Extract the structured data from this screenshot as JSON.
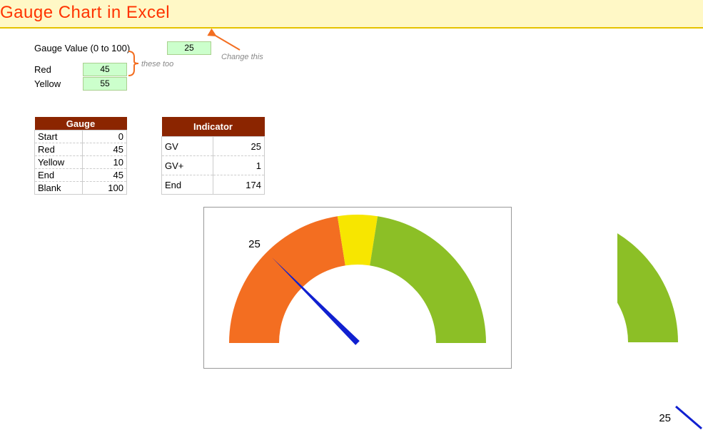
{
  "title": "Gauge Chart in Excel",
  "inputs": {
    "gauge_value_label": "Gauge Value (0 to 100)",
    "gauge_value": "25",
    "red_label": "Red",
    "red_value": "45",
    "yellow_label": "Yellow",
    "yellow_value": "55"
  },
  "notes": {
    "change_this": "Change this",
    "these_too": "these too"
  },
  "tables": {
    "gauge": {
      "header": "Gauge",
      "rows": [
        {
          "label": "Start",
          "value": "0"
        },
        {
          "label": "Red",
          "value": "45"
        },
        {
          "label": "Yellow",
          "value": "10"
        },
        {
          "label": "End",
          "value": "45"
        },
        {
          "label": "Blank",
          "value": "100"
        }
      ]
    },
    "indicator": {
      "header": "Indicator",
      "rows": [
        {
          "label": "GV",
          "value": "25"
        },
        {
          "label": "GV+",
          "value": "1"
        },
        {
          "label": "End",
          "value": "174"
        }
      ]
    }
  },
  "chart_data": {
    "type": "pie",
    "title": "",
    "gauge_value": 25,
    "needle_label": "25",
    "donut_series": {
      "name": "Gauge",
      "segments": [
        {
          "name": "Start",
          "value": 0,
          "color": "none"
        },
        {
          "name": "Red",
          "value": 45,
          "color": "#f36e21"
        },
        {
          "name": "Yellow",
          "value": 10,
          "color": "#f7e600"
        },
        {
          "name": "End",
          "value": 45,
          "color": "#8cbf26"
        },
        {
          "name": "Blank",
          "value": 100,
          "color": "none"
        }
      ]
    },
    "indicator_series": {
      "name": "Indicator",
      "segments": [
        {
          "name": "GV",
          "value": 25,
          "color": "none"
        },
        {
          "name": "GV+",
          "value": 1,
          "color": "#1020d0"
        },
        {
          "name": "End",
          "value": 174,
          "color": "none"
        }
      ]
    }
  }
}
